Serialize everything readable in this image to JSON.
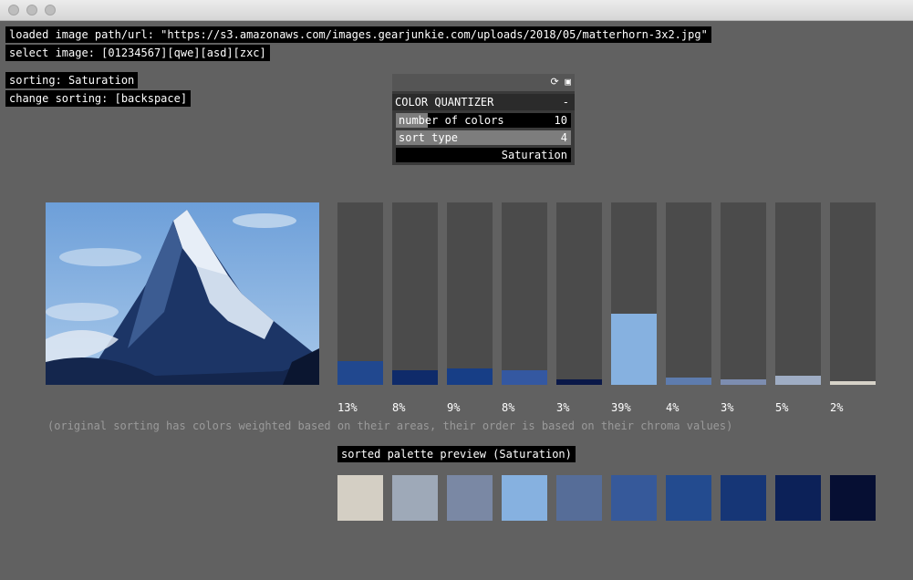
{
  "window": {
    "buttons": [
      "close",
      "minimize",
      "zoom"
    ]
  },
  "info": {
    "loaded_path": "loaded image path/url: \"https://s3.amazonaws.com/images.gearjunkie.com/uploads/2018/05/matterhorn-3x2.jpg\"",
    "select_image": "select image: [01234567][qwe][asd][zxc]",
    "sorting": "sorting: Saturation",
    "change_sorting": "change sorting: [backspace]"
  },
  "panel": {
    "header_icons": [
      "reload-icon",
      "save-icon"
    ],
    "group_title": "COLOR QUANTIZER",
    "collapse_symbol": "-",
    "sliders": [
      {
        "label": "number of colors",
        "value": "10",
        "fill": 0.18
      },
      {
        "label": "sort type",
        "value": "4",
        "fill": 1.0
      }
    ],
    "dropdown_value": "Saturation"
  },
  "chart_data": {
    "type": "bar",
    "categories": [
      "13%",
      "8%",
      "9%",
      "8%",
      "3%",
      "39%",
      "4%",
      "3%",
      "5%",
      "2%"
    ],
    "values": [
      13,
      8,
      9,
      8,
      3,
      39,
      4,
      3,
      5,
      2
    ],
    "colors": [
      "#21488f",
      "#0f2b6a",
      "#173e86",
      "#3458a1",
      "#0a1848",
      "#86b1e0",
      "#5e7cae",
      "#7d8db0",
      "#9fadc4",
      "#d6d2c8"
    ],
    "ylim": [
      0,
      100
    ]
  },
  "note": "(original sorting has colors weighted based on their areas, their order is based on their chroma values)",
  "preview": {
    "title": "sorted palette preview (Saturation)",
    "swatches": [
      "#d4cfc4",
      "#9ea9b8",
      "#7a88a4",
      "#86b1e0",
      "#566d98",
      "#36599a",
      "#234b8f",
      "#163676",
      "#0c2158",
      "#060f33"
    ]
  }
}
